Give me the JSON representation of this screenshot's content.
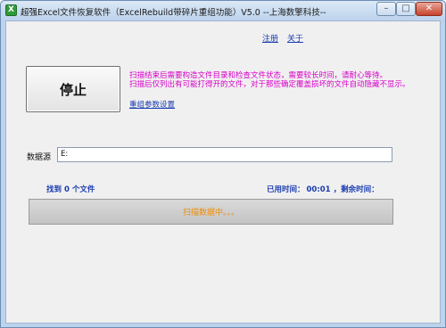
{
  "window": {
    "title": "超强Excel文件恢复软件（ExcelRebuild带碎片重组功能）V5.0 --上海数擎科技--",
    "app_icon": "excel-icon",
    "controls": {
      "minimize": "–",
      "maximize": "□",
      "close": "✕"
    }
  },
  "links": {
    "register": "注册",
    "about": "关于",
    "reset_params": "重组参数设置"
  },
  "stop_button": {
    "label": "停止"
  },
  "hints": {
    "line1": "扫描结束后需要构造文件目录和检查文件状态，需要较长时间，请耐心等待。",
    "line2": "扫描后仅列出有可能打得开的文件，对于那些确定覆盖损坏的文件自动隐藏不显示。"
  },
  "source": {
    "label": "数据源",
    "value": "E:"
  },
  "status": {
    "found_files": "找到 0 个文件",
    "elapsed_label": "已用时间：",
    "elapsed_value": "00:01",
    "remaining_label": "，剩余时间："
  },
  "progress": {
    "percent": 0,
    "text": "扫描数据中。。。"
  },
  "colors": {
    "link": "#1a3cb0",
    "hint": "#d800c8",
    "progress_text": "#f08b00",
    "title_bg": "#bcd3ec"
  }
}
